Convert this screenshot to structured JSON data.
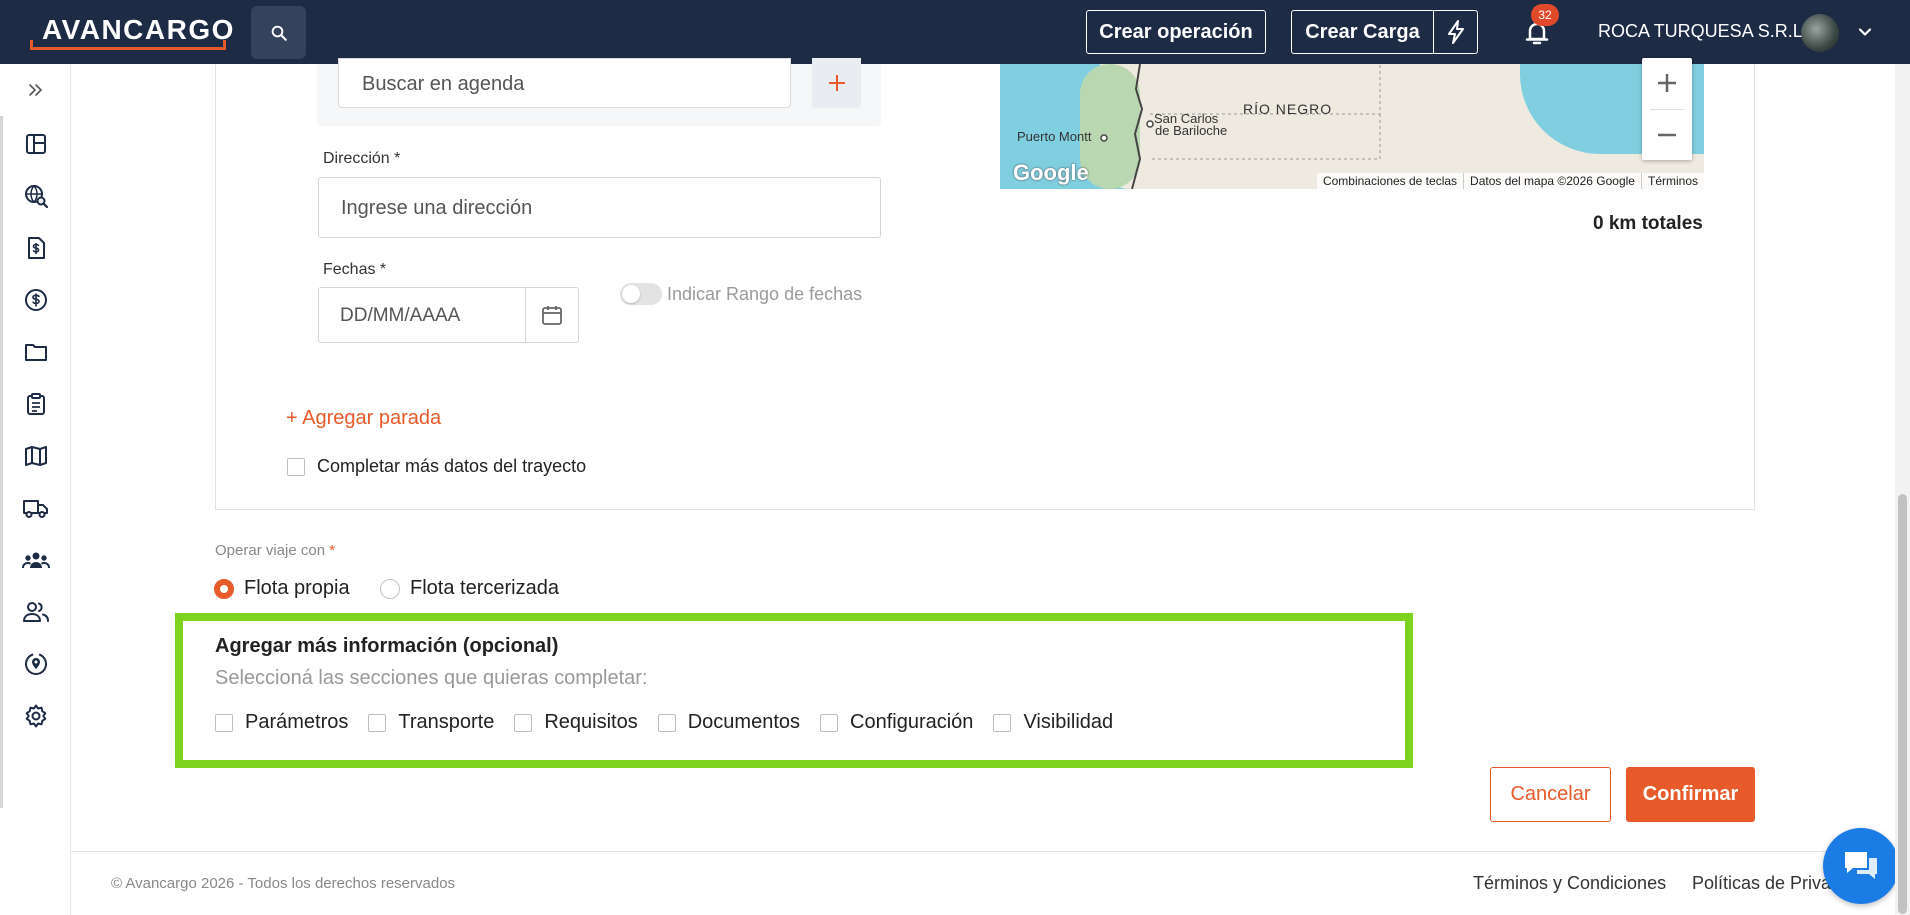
{
  "header": {
    "logo_text": "AVANCARGO",
    "crear_operacion": "Crear operación",
    "crear_carga": "Crear Carga",
    "notifications_count": "32",
    "company_name": "ROCA TURQUESA S.R.L."
  },
  "sidebar": {
    "icons": [
      "expand-icon",
      "dashboard-icon",
      "tracking-search-icon",
      "invoice-icon",
      "money-icon",
      "folder-icon",
      "clipboard-icon",
      "map-icon",
      "truck-icon",
      "team-icon",
      "contacts-icon",
      "location-icon",
      "gear-icon"
    ]
  },
  "form": {
    "agenda_placeholder": "Buscar en agenda",
    "direccion_label": "Dirección",
    "direccion_placeholder": "Ingrese una dirección",
    "fechas_label": "Fechas",
    "date_placeholder": "DD/MM/AAAA",
    "rango_label": "Indicar Rango de fechas",
    "agregar_parada": "+ Agregar parada",
    "completar_datos": "Completar más datos del trayecto",
    "required_mark": "*"
  },
  "map": {
    "labels": {
      "puerto_montt": "Puerto Montt",
      "bariloche_1": "San Carlos",
      "bariloche_2": "de Bariloche",
      "rio_negro": "RÍO NEGRO"
    },
    "google": "Google",
    "attribution": [
      "Combinaciones de teclas",
      "Datos del mapa ©2026 Google",
      "Términos"
    ],
    "km_total": "0 km totales"
  },
  "operar": {
    "label": "Operar viaje con",
    "required_mark": "*",
    "options": [
      {
        "label": "Flota propia",
        "selected": true
      },
      {
        "label": "Flota tercerizada",
        "selected": false
      }
    ]
  },
  "optional": {
    "title": "Agregar más información (opcional)",
    "subtitle": "Seleccioná las secciones que quieras completar:",
    "sections": [
      "Parámetros",
      "Transporte",
      "Requisitos",
      "Documentos",
      "Configuración",
      "Visibilidad"
    ]
  },
  "actions": {
    "cancel": "Cancelar",
    "confirm": "Confirmar"
  },
  "footer": {
    "copyright": "© Avancargo 2026 - Todos los derechos reservados",
    "terms": "Términos y Condiciones",
    "privacy": "Políticas de Privacidad"
  },
  "colors": {
    "accent": "#e85a2a",
    "header_bg": "#1d2b44",
    "highlight": "#7ed321",
    "chat": "#1c7ce5"
  }
}
